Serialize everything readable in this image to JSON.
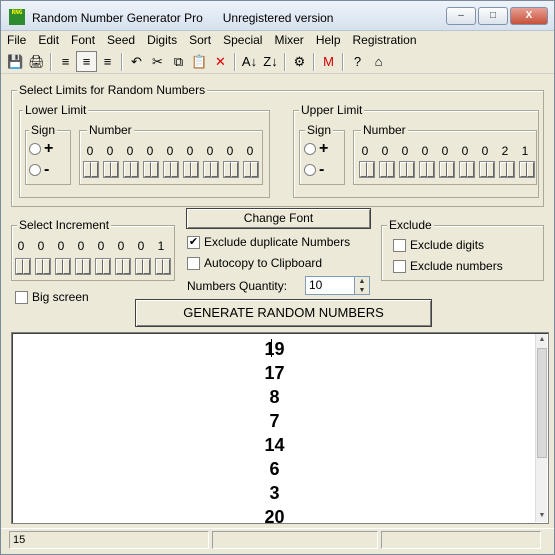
{
  "window": {
    "icon_text": "RNG",
    "title": "Random Number Generator Pro      Unregistered version",
    "min": "–",
    "max": "□",
    "close": "X"
  },
  "menu": [
    "File",
    "Edit",
    "Font",
    "Seed",
    "Digits",
    "Sort",
    "Special",
    "Mixer",
    "Help",
    "Registration"
  ],
  "toolbar": [
    {
      "name": "save-icon",
      "glyph": "💾"
    },
    {
      "name": "print-icon",
      "glyph": "🖨"
    },
    {
      "sep": true
    },
    {
      "name": "align-left-icon",
      "glyph": "≡"
    },
    {
      "name": "align-center-icon",
      "glyph": "≡",
      "pressed": true
    },
    {
      "name": "align-right-icon",
      "glyph": "≡"
    },
    {
      "sep": true
    },
    {
      "name": "undo-icon",
      "glyph": "↶"
    },
    {
      "name": "cut-icon",
      "glyph": "✂"
    },
    {
      "name": "copy-icon",
      "glyph": "⧉"
    },
    {
      "name": "paste-icon",
      "glyph": "📋"
    },
    {
      "name": "delete-icon",
      "glyph": "✕",
      "color": "#e00000"
    },
    {
      "sep": true
    },
    {
      "name": "sort-ascending-icon",
      "glyph": "A↓"
    },
    {
      "name": "sort-descending-icon",
      "glyph": "Z↓"
    },
    {
      "sep": true
    },
    {
      "name": "mixer-icon",
      "glyph": "⚙"
    },
    {
      "sep": true
    },
    {
      "name": "m-icon",
      "glyph": "M",
      "color": "#d00000"
    },
    {
      "sep": true
    },
    {
      "name": "help-icon",
      "glyph": "?"
    },
    {
      "name": "home-icon",
      "glyph": "⌂"
    }
  ],
  "limits": {
    "title": "Select Limits for Random Numbers",
    "lower": {
      "title": "Lower Limit",
      "sign_label": "Sign",
      "number_label": "Number",
      "plus": "+",
      "minus": "-",
      "digits": [
        "0",
        "0",
        "0",
        "0",
        "0",
        "0",
        "0",
        "0",
        "0"
      ]
    },
    "upper": {
      "title": "Upper Limit",
      "sign_label": "Sign",
      "number_label": "Number",
      "plus": "+",
      "minus": "-",
      "digits": [
        "0",
        "0",
        "0",
        "0",
        "0",
        "0",
        "0",
        "2",
        "1"
      ]
    }
  },
  "increment": {
    "title": "Select Increment",
    "digits": [
      "0",
      "0",
      "0",
      "0",
      "0",
      "0",
      "0",
      "1"
    ]
  },
  "options": {
    "change_font": "Change Font",
    "exclude_duplicates": "Exclude duplicate Numbers",
    "exclude_duplicates_checked": true,
    "autocopy": "Autocopy to Clipboard",
    "autocopy_checked": false,
    "quantity_label": "Numbers Quantity:",
    "quantity_value": "10",
    "big_screen": "Big screen",
    "big_screen_checked": false
  },
  "exclude": {
    "title": "Exclude",
    "digits": "Exclude digits",
    "numbers": "Exclude numbers"
  },
  "generate_button": "GENERATE RANDOM NUMBERS",
  "output": {
    "numbers": [
      "19",
      "17",
      "8",
      "7",
      "14",
      "6",
      "3",
      "20"
    ]
  },
  "status": {
    "count": "15",
    "panel2": "",
    "panel3": ""
  }
}
